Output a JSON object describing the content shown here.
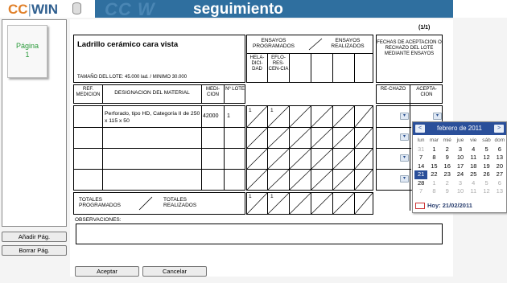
{
  "header": {
    "logo_cc": "CC",
    "logo_sep": "|",
    "logo_win": "WIN",
    "ghost_text": "CC W",
    "module_title": "seguimiento"
  },
  "left_panel": {
    "page_label": "Página",
    "page_number": "1",
    "add_page": "Añadir Pág.",
    "delete_page": "Borrar Pág."
  },
  "sheet": {
    "page_indicator": "(1/1)",
    "material_title": "Ladrillo cerámico cara vista",
    "lot_size": "TAMAÑO DEL LOTE: 45.000 lad. / MINIMO 30.000",
    "ensayos_programados": "ENSAYOS PROGRAMADOS",
    "ensayos_realizados": "ENSAYOS REALIZADOS",
    "ensayo_cols": [
      "HELA-DICI-DAD",
      "EFLO-RES-CEN-CIA"
    ],
    "fechas_header": "FECHAS DE ACEPTACION O RECHAZO DEL LOTE MEDIANTE ENSAYOS",
    "col_ref": "REF. MEDICION",
    "col_designacion": "DESIGNACION DEL MATERIAL",
    "col_medicion": "MEDI-CION",
    "col_lote": "Nº LOTE",
    "col_rechazo": "RE-CHAZO",
    "col_aceptacion": "ACEPTA-CION",
    "row1": {
      "designacion": "Perforado, tipo HD, Categoría II de 250 x 115 x 50",
      "medicion": "42000",
      "lote": "1",
      "prog1": "1",
      "prog2": "1"
    },
    "totales_programados": "TOTALES PROGRAMADOS",
    "totales_realizados": "TOTALES REALIZADOS",
    "totales_prog1": "1",
    "totales_prog2": "1",
    "observaciones": "OBSERVACIONES:"
  },
  "calendar": {
    "month_label": "febrero de 2011",
    "prev": "<",
    "next": ">",
    "days_of_week": [
      "lun",
      "mar",
      "mié",
      "jue",
      "vie",
      "sáb",
      "dom"
    ],
    "weeks": [
      [
        "31",
        "1",
        "2",
        "3",
        "4",
        "5",
        "6"
      ],
      [
        "7",
        "8",
        "9",
        "10",
        "11",
        "12",
        "13"
      ],
      [
        "14",
        "15",
        "16",
        "17",
        "18",
        "19",
        "20"
      ],
      [
        "21",
        "22",
        "23",
        "24",
        "25",
        "26",
        "27"
      ],
      [
        "28",
        "1",
        "2",
        "3",
        "4",
        "5",
        "6"
      ],
      [
        "7",
        "8",
        "9",
        "10",
        "11",
        "12",
        "13"
      ]
    ],
    "today_label": "Hoy: 21/02/2011"
  },
  "footer": {
    "accept": "Aceptar",
    "cancel": "Cancelar"
  },
  "dropdown_glyph": "▾"
}
